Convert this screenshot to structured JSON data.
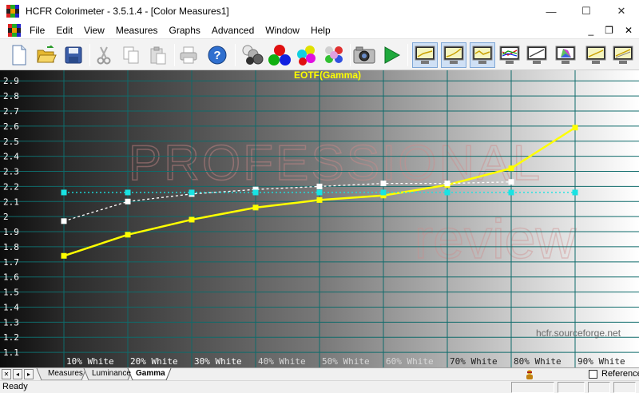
{
  "window": {
    "title": "HCFR Colorimeter - 3.5.1.4 - [Color Measures1]",
    "controls": {
      "minimize": "—",
      "maximize": "☐",
      "close": "✕"
    }
  },
  "menu": {
    "items": [
      "File",
      "Edit",
      "View",
      "Measures",
      "Graphs",
      "Advanced",
      "Window",
      "Help"
    ],
    "mdi": {
      "minimize": "_",
      "restore": "❐",
      "close": "✕"
    }
  },
  "toolbar": {
    "buttons": [
      {
        "name": "new-icon"
      },
      {
        "name": "open-icon"
      },
      {
        "name": "save-icon"
      },
      {
        "name": "cut-icon"
      },
      {
        "name": "copy-icon"
      },
      {
        "name": "paste-icon"
      },
      {
        "name": "print-icon"
      },
      {
        "name": "help-icon"
      },
      {
        "name": "measure-gray-icon"
      },
      {
        "name": "measure-primaries-icon"
      },
      {
        "name": "measure-secondaries-icon"
      },
      {
        "name": "measure-saturation-icon"
      },
      {
        "name": "camera-icon"
      },
      {
        "name": "play-icon"
      },
      {
        "name": "graph-view-1-icon"
      },
      {
        "name": "graph-view-2-icon"
      },
      {
        "name": "graph-view-3-icon"
      },
      {
        "name": "rgb-levels-icon"
      },
      {
        "name": "graph-view-5-icon"
      },
      {
        "name": "cie-chart-icon"
      },
      {
        "name": "graph-view-7-icon"
      },
      {
        "name": "graph-view-8-icon"
      }
    ]
  },
  "chart_data": {
    "type": "line",
    "title": "EOTF(Gamma)",
    "categories": [
      "10% White",
      "20% White",
      "30% White",
      "40% White",
      "50% White",
      "60% White",
      "70% White",
      "80% White",
      "90% White"
    ],
    "y_ticks": [
      "1.1",
      "1.2",
      "1.3",
      "1.4",
      "1.5",
      "1.6",
      "1.7",
      "1.8",
      "1.9",
      "2",
      "2.1",
      "2.2",
      "2.3",
      "2.4",
      "2.5",
      "2.6",
      "2.7",
      "2.8",
      "2.9"
    ],
    "ylim": [
      1.0,
      2.97
    ],
    "grid": true,
    "series": [
      {
        "color": "#ffff00",
        "style": "solid",
        "values": [
          1.74,
          1.88,
          1.98,
          2.06,
          2.11,
          2.14,
          2.21,
          2.32,
          2.59
        ]
      },
      {
        "color": "#ffffff",
        "style": "dashed",
        "values": [
          1.97,
          2.1,
          2.15,
          2.18,
          2.2,
          2.22,
          2.22,
          2.23,
          null
        ]
      },
      {
        "color": "#19e3e3",
        "style": "dotted",
        "values": [
          2.16,
          2.16,
          2.16,
          2.16,
          2.16,
          2.16,
          2.16,
          2.16,
          2.16
        ]
      }
    ],
    "watermark": [
      "professional",
      "review"
    ],
    "credit": "hcfr.sourceforge.net"
  },
  "tabs": {
    "nav": [
      "✕",
      "◂",
      "▸"
    ],
    "items": [
      "Measures",
      "Luminance",
      "Gamma"
    ],
    "active": "Gamma",
    "reference_label": "Reference"
  },
  "status": {
    "text": "Ready"
  }
}
